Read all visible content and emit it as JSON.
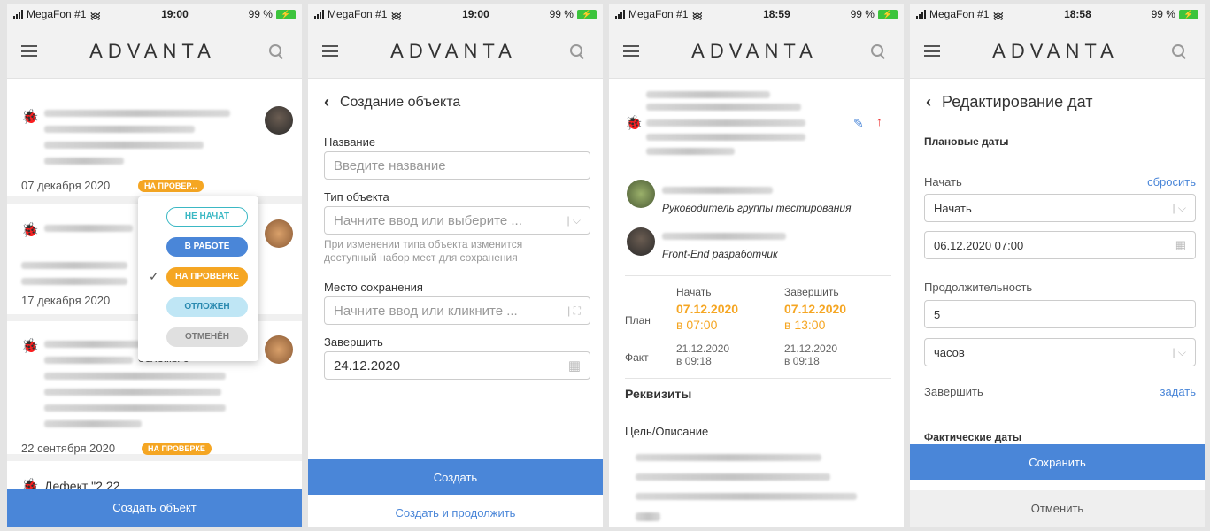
{
  "status": {
    "s1": {
      "carrier": "MegaFon #1",
      "time": "19:00",
      "battery": "99 %"
    },
    "s2": {
      "carrier": "MegaFon #1",
      "time": "19:00",
      "battery": "99 %"
    },
    "s3": {
      "carrier": "MegaFon #1",
      "time": "18:59",
      "battery": "99 %"
    },
    "s4": {
      "carrier": "MegaFon #1",
      "time": "18:58",
      "battery": "99 %"
    }
  },
  "brand": {
    "logo": "ADVANTA",
    "accent": "#4a86d8",
    "orange": "#f5a623"
  },
  "s1": {
    "cards": [
      {
        "date": "07 декабря 2020",
        "badge": "НА ПРОВЕР..."
      },
      {
        "date": "17 декабря 2020"
      },
      {
        "partial_text": "облемы с",
        "date": "22 сентября 2020",
        "badge": "НА ПРОВЕРКЕ"
      },
      {
        "title": "Дефект \"2.22"
      }
    ],
    "status_menu": [
      {
        "label": "НЕ НАЧАТ",
        "color": "#3bb8c4",
        "style": "outline",
        "selected": false
      },
      {
        "label": "В РАБОТЕ",
        "color": "#4a86d8",
        "style": "fill",
        "selected": false
      },
      {
        "label": "НА ПРОВЕРКЕ",
        "color": "#f5a623",
        "style": "fill",
        "selected": true
      },
      {
        "label": "ОТЛОЖЕН",
        "color": "#bfe6f5",
        "style": "light",
        "selected": false
      },
      {
        "label": "ОТМЕНЁН",
        "color": "#e0e0e0",
        "style": "light",
        "selected": false
      }
    ],
    "bottom_button": "Создать объект"
  },
  "s2": {
    "title": "Создание объекта",
    "name_label": "Название",
    "name_placeholder": "Введите название",
    "type_label": "Тип объекта",
    "type_placeholder": "Начните ввод или выберите ...",
    "type_hint": "При изменении типа объекта изменится доступный набор мест для сохранения",
    "place_label": "Место сохранения",
    "place_placeholder": "Начните ввод или кликните ...",
    "finish_label": "Завершить",
    "finish_value": "24.12.2020",
    "create_button": "Создать",
    "create_continue": "Создать и продолжить"
  },
  "s3": {
    "people": [
      {
        "role": "Руководитель группы тестирования"
      },
      {
        "role": "Front-End разработчик"
      }
    ],
    "col_start": "Начать",
    "col_end": "Завершить",
    "plan_label": "План",
    "plan_start_date": "07.12.2020",
    "plan_start_time": "в 07:00",
    "plan_end_date": "07.12.2020",
    "plan_end_time": "в 13:00",
    "fact_label": "Факт",
    "fact_start_date": "21.12.2020",
    "fact_start_time": "в 09:18",
    "fact_end_date": "21.12.2020",
    "fact_end_time": "в 09:18",
    "requisites": "Реквизиты",
    "goal_label": "Цель/Описание"
  },
  "s4": {
    "title": "Редактирование дат",
    "planned": "Плановые даты",
    "start_label": "Начать",
    "reset": "сбросить",
    "start_select": "Начать",
    "start_datetime": "06.12.2020 07:00",
    "duration_label": "Продолжительность",
    "duration_value": "5",
    "unit": "часов",
    "finish_label": "Завершить",
    "set": "задать",
    "actual": "Фактические даты",
    "save": "Сохранить",
    "cancel": "Отменить"
  }
}
